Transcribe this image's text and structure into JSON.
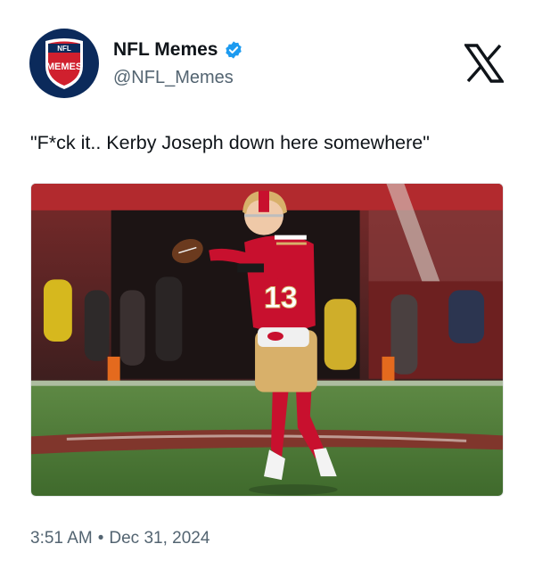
{
  "account": {
    "display_name": "NFL Memes",
    "handle": "@NFL_Memes",
    "verified": true,
    "avatar_icon": "nfl-memes-shield-logo",
    "avatar_text_top": "NFL",
    "avatar_text_main": "MEMES"
  },
  "platform_icon": "x-logo-icon",
  "tweet": {
    "text": "\"F*ck it.. Kerby Joseph down here somewhere\""
  },
  "media": {
    "description_icon": "football-player-photo",
    "jersey_number": "13"
  },
  "meta": {
    "time": "3:51 AM",
    "separator": "•",
    "date": "Dec 31, 2024"
  },
  "colors": {
    "verified_badge": "#1d9bf0",
    "avatar_bg": "#0b2a5b",
    "niners_red": "#c8102e",
    "niners_gold": "#d8b06a",
    "secondary_text": "#536471"
  }
}
